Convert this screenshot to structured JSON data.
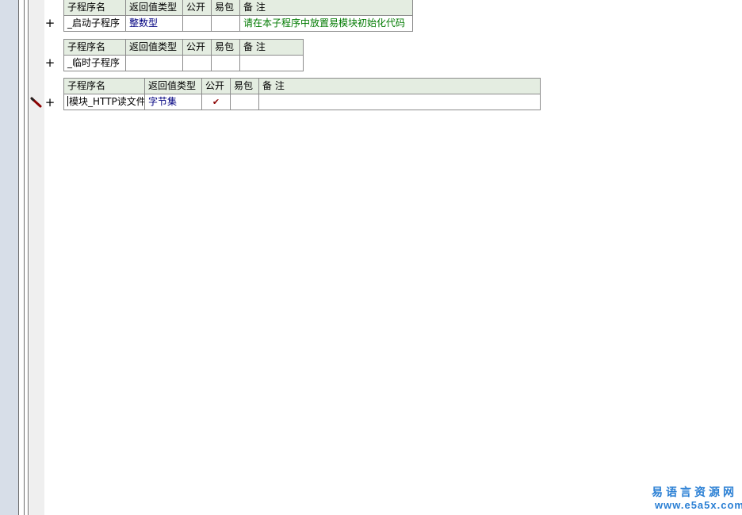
{
  "headers": {
    "name": "子程序名",
    "return_type": "返回值类型",
    "public": "公开",
    "easy_pkg": "易包",
    "note": "备 注"
  },
  "subroutines": [
    {
      "name": "_启动子程序",
      "return_type": "整数型",
      "public_checked": false,
      "easy_pkg": "",
      "note": "请在本子程序中放置易模块初始化代码"
    },
    {
      "name": "_临时子程序",
      "return_type": "",
      "public_checked": false,
      "easy_pkg": "",
      "note": ""
    },
    {
      "name": "模块_HTTP读文件",
      "return_type": "字节集",
      "public_checked": true,
      "public_mark": "✔",
      "easy_pkg": "",
      "note": ""
    }
  ],
  "expander_symbol": "+",
  "watermark": {
    "line1": "易语言资源网",
    "line2": "www.e5a5x.com"
  },
  "colors": {
    "header_bg": "#e4ede1",
    "type_text": "#000080",
    "note_text": "#007a00",
    "check_mark": "#8b0000",
    "watermark": "#2a7fd4"
  },
  "icons": {
    "edit_marker": "pencil-icon",
    "expand": "plus-icon"
  }
}
